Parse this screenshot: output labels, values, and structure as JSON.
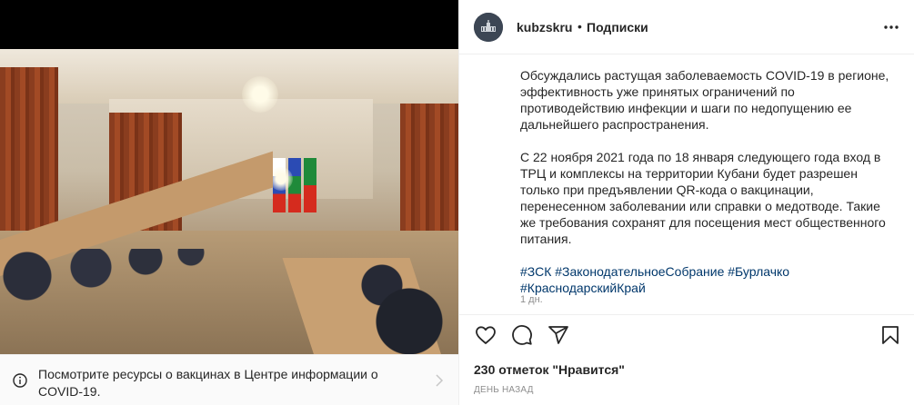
{
  "post": {
    "image_alt": "",
    "covid_banner": {
      "text": "Посмотрите ресурсы о вакцинах в Центре информации о COVID-19.",
      "icon": "info-icon"
    }
  },
  "header": {
    "username": "kubzskru",
    "separator": "•",
    "follow_label": "Подписки",
    "more_icon": "more-options-icon"
  },
  "caption": {
    "paragraph_1": "Обсуждались растущая заболеваемость COVID-19 в регионе, эффективность уже принятых ограничений по противодействию инфекции и шаги по недопущению ее дальнейшего распространения.",
    "paragraph_2": "С 22 ноября 2021 года по 18 января следующего года вход в ТРЦ и комплексы на территории Кубани будет разрешен только при предъявлении QR-кода о вакцинации, перенесенном заболевании или справки о медотводе. Такие же требования сохранят для посещения мест общественного питания.",
    "hashtags": [
      "#ЗСК",
      "#ЗаконодательноеСобрание",
      "#Бурлачко",
      "#КраснодарскийКрай"
    ],
    "time": "1 дн."
  },
  "actions": {
    "like_icon": "heart-icon",
    "comment_icon": "comment-icon",
    "share_icon": "paper-plane-icon",
    "save_icon": "bookmark-icon"
  },
  "likes_text": "230 отметок \"Нравится\"",
  "post_time": "День назад",
  "colors": {
    "text": "#262626",
    "muted": "#8e8e8e",
    "link": "#00376b",
    "border": "#efefef"
  }
}
